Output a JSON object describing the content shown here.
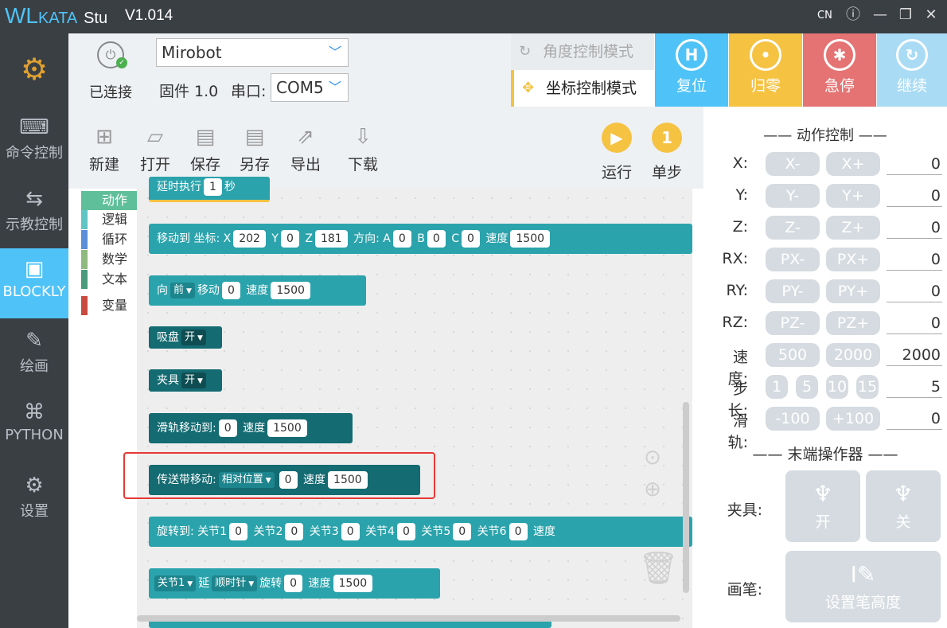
{
  "app": {
    "logo": "WL",
    "logo_small": "KATA",
    "logo_tail": "Stu",
    "version": "V1.014",
    "lang": "CN"
  },
  "sidebar": {
    "items": [
      {
        "label": ""
      },
      {
        "label": "命令控制"
      },
      {
        "label": "示教控制"
      },
      {
        "label": "BLOCKLY"
      },
      {
        "label": "绘画"
      },
      {
        "label": "PYTHON"
      },
      {
        "label": "设置"
      }
    ]
  },
  "connection": {
    "status": "已连接",
    "device": "Mirobot",
    "firmware": "固件 1.0",
    "port_label": "串口:",
    "port": "COM5"
  },
  "modes": {
    "angle": "角度控制模式",
    "coord": "坐标控制模式"
  },
  "actions": {
    "reset": "复位",
    "home": "归零",
    "stop": "急停",
    "resume": "继续"
  },
  "toolbar": {
    "new": "新建",
    "open": "打开",
    "save": "保存",
    "saveas": "另存",
    "export": "导出",
    "download": "下载",
    "run": "运行",
    "step": "单步"
  },
  "categories": [
    "动作",
    "逻辑",
    "循环",
    "数学",
    "文本",
    "变量"
  ],
  "blocks": {
    "b0": {
      "t1": "延时执行",
      "v1": "1",
      "t2": "秒"
    },
    "b1": {
      "t1": "移动到",
      "t2": "坐标:",
      "x": "202",
      "y": "0",
      "z": "181",
      "t3": "方向:",
      "a": "0",
      "b": "0",
      "c": "0",
      "spd_l": "速度",
      "spd": "1500"
    },
    "b2": {
      "t1": "向",
      "dir": "前",
      "t2": "移动",
      "v": "0",
      "spd_l": "速度",
      "spd": "1500"
    },
    "b3": {
      "t1": "吸盘",
      "v": "开"
    },
    "b4": {
      "t1": "夹具",
      "v": "开"
    },
    "b5": {
      "t1": "滑轨移动到:",
      "v": "0",
      "spd_l": "速度",
      "spd": "1500"
    },
    "b6": {
      "t1": "传送带移动:",
      "mode": "相对位置",
      "v": "0",
      "spd_l": "速度",
      "spd": "1500"
    },
    "b7": {
      "t1": "旋转到:",
      "j1": "关节1",
      "v1": "0",
      "j2": "关节2",
      "v2": "0",
      "j3": "关节3",
      "v3": "0",
      "j4": "关节4",
      "v4": "0",
      "j5": "关节5",
      "v5": "0",
      "j6": "关节6",
      "v6": "0",
      "spd_l": "速度"
    },
    "b8": {
      "joint": "关节1",
      "t1": "延",
      "dir": "顺时针",
      "t2": "旋转",
      "v": "0",
      "spd_l": "速度",
      "spd": "1500"
    }
  },
  "control": {
    "title": "—— 动作控制 ——",
    "rows": [
      {
        "label": "X:",
        "minus": "X-",
        "plus": "X+",
        "value": "0"
      },
      {
        "label": "Y:",
        "minus": "Y-",
        "plus": "Y+",
        "value": "0"
      },
      {
        "label": "Z:",
        "minus": "Z-",
        "plus": "Z+",
        "value": "0"
      },
      {
        "label": "RX:",
        "minus": "PX-",
        "plus": "PX+",
        "value": "0"
      },
      {
        "label": "RY:",
        "minus": "PY-",
        "plus": "PY+",
        "value": "0"
      },
      {
        "label": "RZ:",
        "minus": "PZ-",
        "plus": "PZ+",
        "value": "0"
      }
    ],
    "speed": {
      "label": "速度:",
      "a": "500",
      "b": "2000",
      "value": "2000"
    },
    "step": {
      "label": "步长:",
      "a": "1",
      "b": "5",
      "c": "10",
      "d": "15",
      "value": "5"
    },
    "rail": {
      "label": "滑轨:",
      "minus": "-100",
      "plus": "+100",
      "value": "0"
    }
  },
  "end_effector": {
    "title": "—— 末端操作器 ——",
    "gripper_label": "夹具:",
    "open": "开",
    "close": "关",
    "pen_label": "画笔:",
    "pen_btn": "设置笔高度"
  },
  "colors": {
    "accent": "#4fc3f7",
    "sidebar": "#3a3f44",
    "block": "#2ba3ac",
    "home": "#f5c242",
    "stop": "#e57373",
    "highlight": "#e53935"
  }
}
